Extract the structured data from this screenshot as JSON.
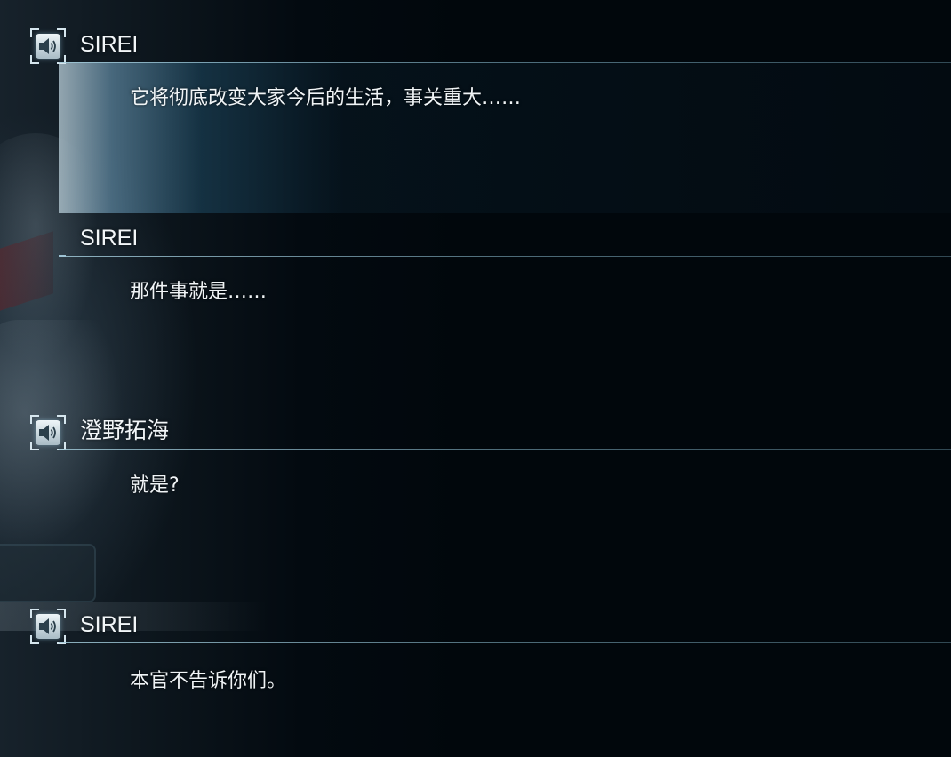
{
  "backlog": {
    "entries": [
      {
        "speaker": "SIREI",
        "has_voice": true,
        "selected": true,
        "text": "它将彻底改变大家今后的生活，事关重大……"
      },
      {
        "speaker": "SIREI",
        "has_voice": false,
        "selected": false,
        "text": "那件事就是……"
      },
      {
        "speaker": "澄野拓海",
        "has_voice": true,
        "selected": false,
        "text": "就是?"
      },
      {
        "speaker": "SIREI",
        "has_voice": true,
        "selected": false,
        "text": "本官不告诉你们。"
      }
    ]
  },
  "icons": {
    "voice_replay": "speaker-icon"
  },
  "colors": {
    "background": "#01070c",
    "text": "#f0f4f6",
    "accent_line": "#9ec3d4",
    "selected_highlight": "#5a829b"
  }
}
